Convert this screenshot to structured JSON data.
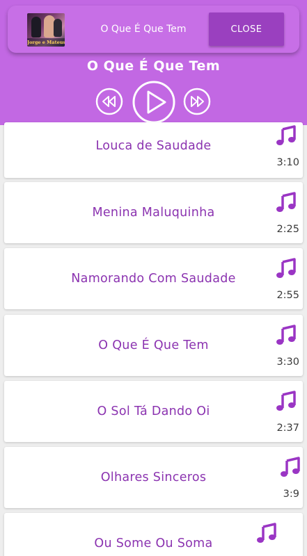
{
  "notification": {
    "album_text": "Jorge e Mateus",
    "title": "O Que É Que Tem",
    "close_label": "CLOSE"
  },
  "player": {
    "now_playing": "O Que É Que Tem"
  },
  "songs": [
    {
      "title": "Louca de Saudade",
      "duration": "3:10"
    },
    {
      "title": "Menina Maluquinha",
      "duration": "2:25"
    },
    {
      "title": "Namorando Com Saudade",
      "duration": "2:55"
    },
    {
      "title": "O Que É Que Tem",
      "duration": "3:30"
    },
    {
      "title": "O Sol Tá Dando Oi",
      "duration": "2:37"
    },
    {
      "title": "Olhares Sinceros",
      "duration": "3:9"
    },
    {
      "title": "Ou Some Ou Soma",
      "duration": ""
    }
  ],
  "colors": {
    "header": "#c268e3",
    "accent": "#9a40bf",
    "song_title": "#8b33b0",
    "note_icon": "#9a35c4"
  },
  "icons": {
    "prev": "rewind-icon",
    "play": "play-icon",
    "next": "fast-forward-icon",
    "song": "music-note-icon"
  }
}
